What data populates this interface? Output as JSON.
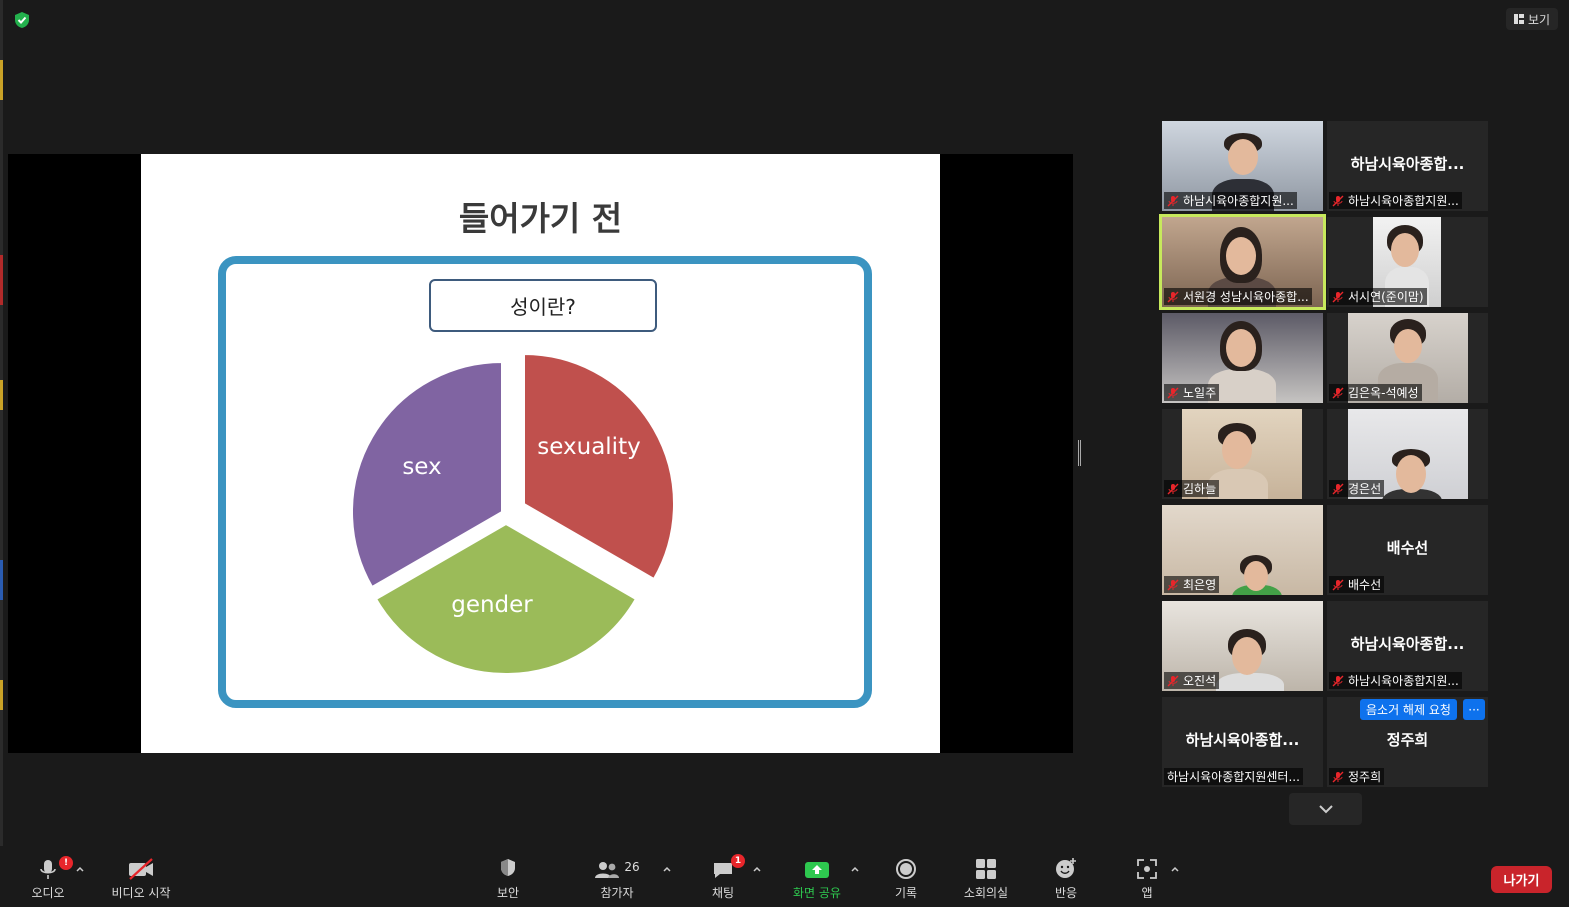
{
  "top": {
    "view_label": "보기"
  },
  "slide": {
    "title": "들어가기 전",
    "box_text": "성이란?",
    "pie": {
      "slices": [
        {
          "label": "sexuality",
          "color": "#c0504d"
        },
        {
          "label": "gender",
          "color": "#9bbb59"
        },
        {
          "label": "sex",
          "color": "#8064a2"
        }
      ]
    }
  },
  "gallery": {
    "tiles": [
      {
        "label": "하남시육아종합지원...",
        "big_name": ""
      },
      {
        "label": "하남시육아종합지원...",
        "big_name": "하남시육아종합..."
      },
      {
        "label": "서원경 성남시육아종합...",
        "big_name": ""
      },
      {
        "label": "서시연(준이맘)",
        "big_name": ""
      },
      {
        "label": "노일주",
        "big_name": ""
      },
      {
        "label": "김은옥-석예성",
        "big_name": ""
      },
      {
        "label": "김하늘",
        "big_name": ""
      },
      {
        "label": "경은선",
        "big_name": ""
      },
      {
        "label": "최은영",
        "big_name": ""
      },
      {
        "label": "배수선",
        "big_name": "배수선"
      },
      {
        "label": "오진석",
        "big_name": ""
      },
      {
        "label": "하남시육아종합지원...",
        "big_name": "하남시육아종합..."
      },
      {
        "label": "하남시육아종합지원센터...",
        "big_name": "하남시육아종합..."
      },
      {
        "label": "정주희",
        "big_name": "정주희"
      }
    ],
    "unmute_request": "음소거 해제 요청",
    "more_label": "···"
  },
  "toolbar": {
    "audio": "오디오",
    "video": "비디오 시작",
    "security": "보안",
    "participants": "참가자",
    "participants_count": "26",
    "chat": "채팅",
    "chat_badge": "1",
    "audio_badge": "!",
    "share": "화면 공유",
    "record": "기록",
    "breakout": "소회의실",
    "reactions": "반응",
    "apps": "앱",
    "leave": "나가기"
  },
  "colors": {
    "accent_green": "#2ec84f",
    "active_speaker": "#c7e95c",
    "leave_red": "#c9242b",
    "request_blue": "#0e72ed",
    "slide_frame": "#3b94c1"
  }
}
